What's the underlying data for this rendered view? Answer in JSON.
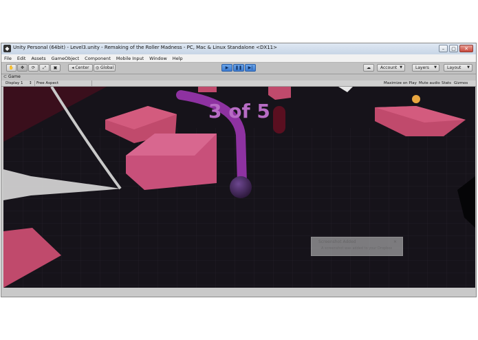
{
  "window": {
    "title": "Unity Personal (64bit) - Level3.unity - Remaking of the Roller Madness - PC, Mac & Linux Standalone <DX11>",
    "minimize": "–",
    "maximize": "▢",
    "close": "✕"
  },
  "menu": [
    "File",
    "Edit",
    "Assets",
    "GameObject",
    "Component",
    "Mobile Input",
    "Window",
    "Help"
  ],
  "toolbar": {
    "pivot": "Center",
    "space": "Global",
    "account": "Account",
    "layers": "Layers",
    "layout": "Layout"
  },
  "game_tab": {
    "label": "Game",
    "display": "Display 1",
    "aspect": "Free Aspect",
    "maximize_on_play": "Maximize on Play",
    "mute_audio": "Mute audio",
    "stats": "Stats",
    "gizmos": "Gizmos"
  },
  "hud": {
    "counter": "3 of 5"
  },
  "notification": {
    "title": "Screenshot Added",
    "body": "A screenshot was added to your Dropbox"
  },
  "colors": {
    "block": "#c04a6c",
    "ground": "#16131a",
    "trail": "#a23cb4",
    "ball": "#4a2a66"
  }
}
